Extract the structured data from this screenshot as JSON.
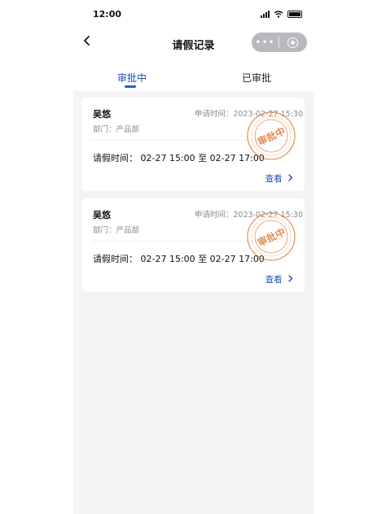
{
  "status_bar": {
    "time": "12:00"
  },
  "nav": {
    "title": "请假记录",
    "back_icon": "chevron-left-icon",
    "more_label": "•••"
  },
  "tabs": [
    {
      "label": "审批中",
      "active": true
    },
    {
      "label": "已审批",
      "active": false
    }
  ],
  "colors": {
    "accent": "#1f4fb5",
    "stamp": "#e07a35",
    "background": "#f4f4f6"
  },
  "records": [
    {
      "name": "吴悠",
      "apply_time": "申请时间：2023-02-27 15:30",
      "department": "部门：产品部",
      "leave_time": "请假时间： 02-27 15:00 至 02-27 17:00",
      "view_label": "查看",
      "stamp_text": "审批中"
    },
    {
      "name": "吴悠",
      "apply_time": "申请时间：2023-02-27 15:30",
      "department": "部门：产品部",
      "leave_time": "请假时间： 02-27 15:00 至 02-27 17:00",
      "view_label": "查看",
      "stamp_text": "审批中"
    }
  ]
}
